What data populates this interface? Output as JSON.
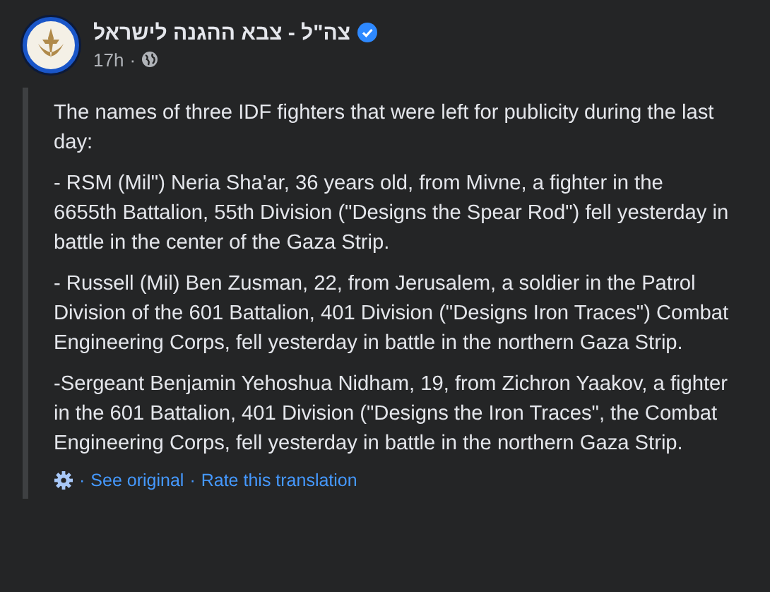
{
  "post": {
    "author": "צה\"ל - צבא ההגנה לישראל",
    "verified": true,
    "time": "17h",
    "separator": "·",
    "paragraphs": [
      "The names of three IDF fighters that were left for publicity during the last day:",
      "- RSM (Mil\") Neria Sha'ar, 36 years old, from Mivne, a fighter in the 6655th Battalion, 55th Division (\"Designs the Spear Rod\") fell yesterday in battle in the center of the Gaza Strip.",
      "- Russell (Mil) Ben Zusman, 22, from Jerusalem, a soldier in the Patrol Division of the 601 Battalion, 401 Division (\"Designs Iron Traces\") Combat Engineering Corps, fell yesterday in battle in the northern Gaza Strip.",
      "-Sergeant Benjamin Yehoshua Nidham, 19, from Zichron Yaakov, a fighter in the 601 Battalion, 401 Division (\"Designs the Iron Traces\", the Combat Engineering Corps, fell yesterday in battle in the northern Gaza Strip."
    ],
    "footer": {
      "separator": "·",
      "links": [
        "See original",
        "Rate this translation"
      ]
    }
  }
}
